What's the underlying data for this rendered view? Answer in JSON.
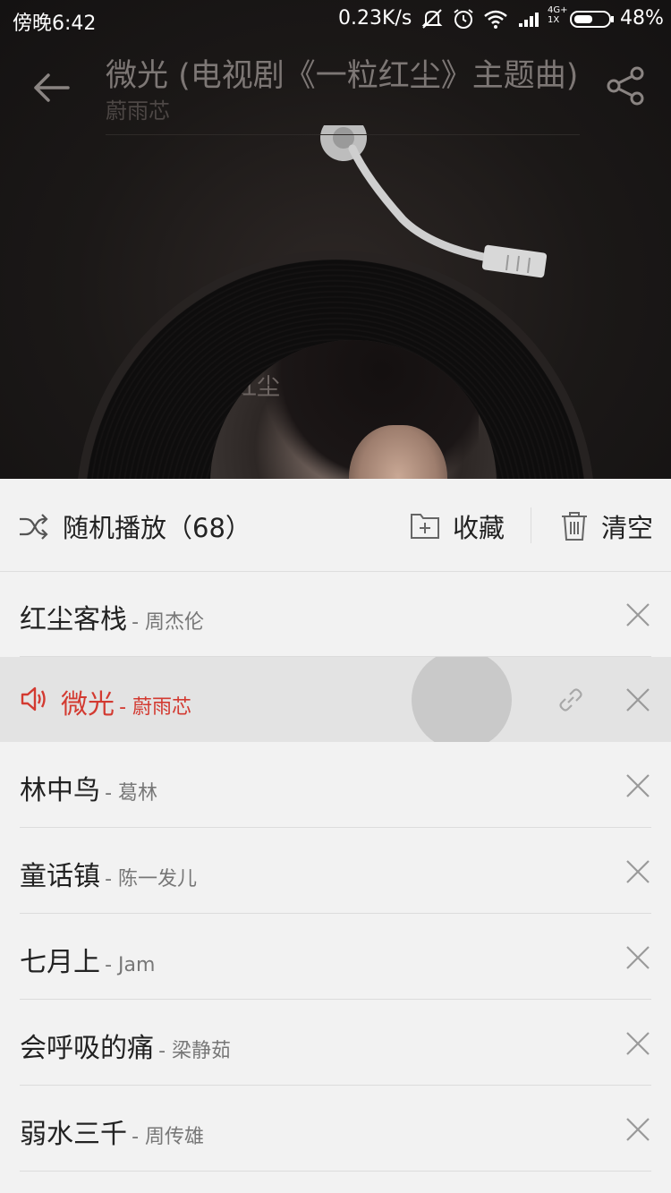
{
  "status_bar": {
    "time": "傍晚6:42",
    "net_speed": "0.23K/s",
    "signal_label": "4G+",
    "signal_sub": "1X",
    "battery": "48%"
  },
  "player": {
    "title": "微光 (电视剧《一粒红尘》主题曲)",
    "artist": "蔚雨芯",
    "album_text": "粒红尘"
  },
  "playlist_header": {
    "shuffle_label": "随机播放（68）",
    "collect_label": "收藏",
    "clear_label": "清空"
  },
  "songs": [
    {
      "name": "红尘客栈",
      "artist": "- 周杰伦",
      "playing": false
    },
    {
      "name": "微光",
      "artist": "- 蔚雨芯",
      "playing": true
    },
    {
      "name": "林中鸟",
      "artist": "- 葛林",
      "playing": false
    },
    {
      "name": "童话镇",
      "artist": "- 陈一发儿",
      "playing": false
    },
    {
      "name": "七月上",
      "artist": "- Jam",
      "playing": false
    },
    {
      "name": "会呼吸的痛",
      "artist": "- 梁静茹",
      "playing": false
    },
    {
      "name": "弱水三千",
      "artist": "- 周传雄",
      "playing": false
    }
  ],
  "colors": {
    "accent": "#d33a31",
    "sheet_bg": "#f2f2f2",
    "playing_row_bg": "#e3e3e3"
  }
}
